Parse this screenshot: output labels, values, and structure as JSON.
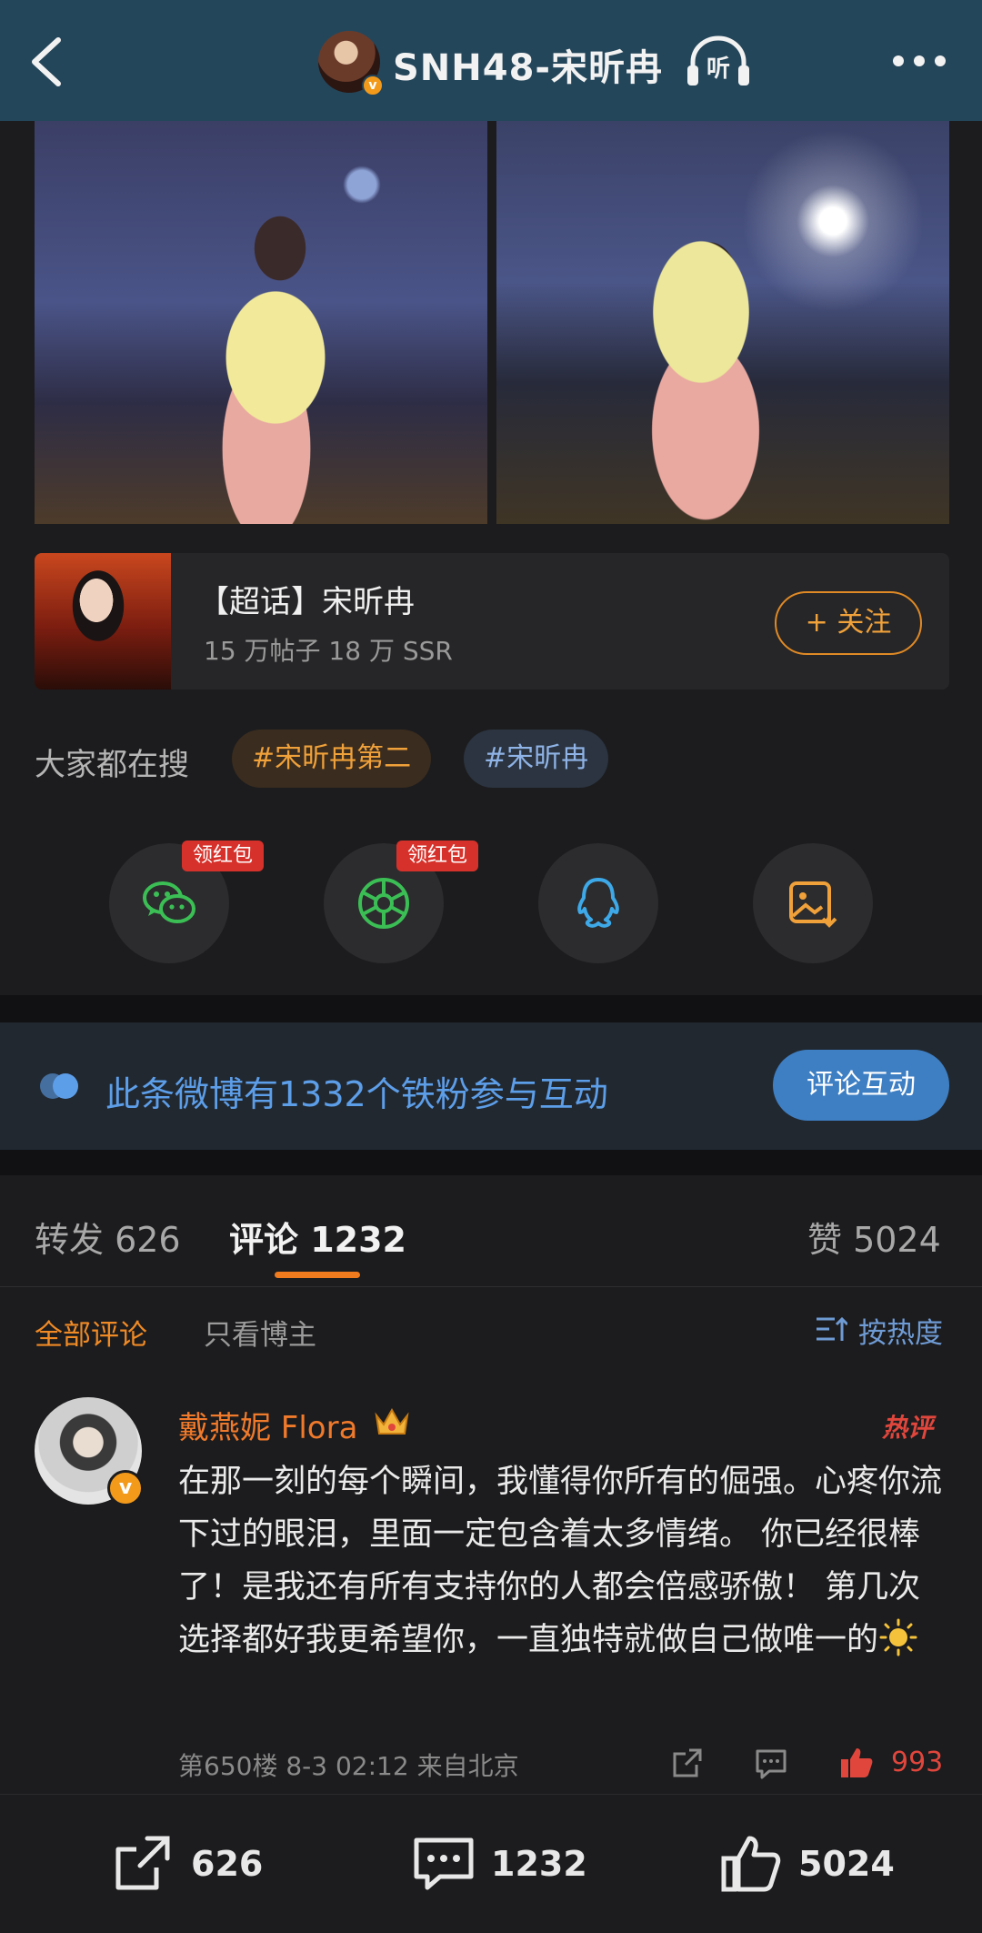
{
  "header": {
    "title": "SNH48-宋昕冉",
    "listen_label": "听",
    "verified_mark": "v"
  },
  "topic": {
    "title": "【超话】宋昕冉",
    "stats": "15 万帖子  18 万 SSR",
    "follow_label": "+ 关注"
  },
  "search": {
    "label": "大家都在搜",
    "chips": [
      "#宋昕冉第二",
      "#宋昕冉"
    ]
  },
  "share": {
    "red_tag": "领红包",
    "buttons": [
      "wechat-icon",
      "moments-icon",
      "qq-icon",
      "save-image-icon"
    ]
  },
  "fan_banner": {
    "text": "此条微博有1332个铁粉参与互动",
    "button_label": "评论互动"
  },
  "tabs": {
    "repost": "转发 626",
    "comment": "评论 1232",
    "like": "赞 5024"
  },
  "filters": {
    "all": "全部评论",
    "host_only": "只看博主",
    "sort": "按热度"
  },
  "comment": {
    "username": "戴燕妮 Flora",
    "hot_tag": "热评",
    "verified_mark": "v",
    "text": "在那一刻的每个瞬间，我懂得你所有的倔强。心疼你流下过的眼泪，里面一定包含着太多情绪。 你已经很棒了！是我还有所有支持你的人都会倍感骄傲！ 第几次选择都好我更希望你，一直独特就做自己做唯一的",
    "meta": "第650楼  8-3 02:12  来自北京",
    "likes": "993"
  },
  "bottom_bar": {
    "reposts": "626",
    "comments": "1232",
    "likes": "5024"
  },
  "colors": {
    "header_bg": "#24465a",
    "accent_orange": "#f07a1e",
    "link_blue": "#5d9ee9",
    "hot_red": "#e0463c"
  }
}
